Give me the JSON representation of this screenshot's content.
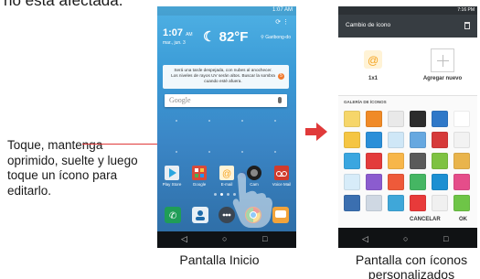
{
  "top_text": "no está afectada.",
  "callout": "Toque, mantenga oprimido, suelte y luego toque un ícono para editarlo.",
  "captions": {
    "home": "Pantalla Inicio",
    "custom": "Pantalla con íconos personalizados"
  },
  "home_screen": {
    "status_time": "1:07 AM",
    "clock": "1:07",
    "clock_ampm": "AM",
    "date": "mar., jun. 3",
    "temperature": "82°F",
    "location": "Garibong-do",
    "weather_text": "Será una tarde despejada, con nubes al anochecer. Los niveles de rayos UV serán altos. Buscar la sombra cuando esté afuera.",
    "weather_badge": "5",
    "search_brand": "Google",
    "apps": [
      {
        "label": "Play Store",
        "color": "#e9eef3",
        "accent": "#2aa6df"
      },
      {
        "label": "Google",
        "color": "#d84a3a",
        "accent": "#ffffff"
      },
      {
        "label": "E-mail",
        "color": "#fff3d6",
        "accent": "#f4a21d"
      },
      {
        "label": "Cam",
        "color": "#1e1e1e",
        "accent": "#888888"
      },
      {
        "label": "Voice Mail",
        "color": "#d23b2c",
        "accent": "#ffffff"
      }
    ],
    "dock_colors": [
      "#1f9d57",
      "#e8f0f6",
      "#3b4652",
      "#e85a2c",
      "#f2a33a"
    ],
    "nav": {
      "back": "◁",
      "home": "○",
      "recent": "□"
    }
  },
  "custom_screen": {
    "status_time": "7:16 PM",
    "header_title": "Cambio de ícono",
    "selected_label": "1x1",
    "add_label": "Agregar nuevo",
    "gallery_title": "GALERÍA DE ÍCONOS",
    "tiles": [
      "#f6d66a",
      "#f08a27",
      "#e9e9e9",
      "#2c2c2c",
      "#2f78c8",
      "#ffffff",
      "#f5c543",
      "#2b8fd8",
      "#cfe7f7",
      "#66a8e0",
      "#d63a3a",
      "#f2f2f2",
      "#3aa6e0",
      "#e33b3b",
      "#f7b64a",
      "#5a5a5a",
      "#7ec242",
      "#e9b44c",
      "#d7ecf9",
      "#8b5ccf",
      "#ee5a3a",
      "#45b663",
      "#1c8fd2",
      "#e54d8a",
      "#3b6fb0",
      "#cfd8e3",
      "#3fa7d9",
      "#e83a3a",
      "#f0f0f0",
      "#6ec547"
    ],
    "cancel_label": "CANCELAR",
    "ok_label": "OK",
    "nav": {
      "back": "◁",
      "home": "○",
      "recent": "□"
    }
  },
  "colors": {
    "accent_red": "#e03a3a",
    "sky_top": "#4fb1e4",
    "header_gray": "#373d42"
  }
}
